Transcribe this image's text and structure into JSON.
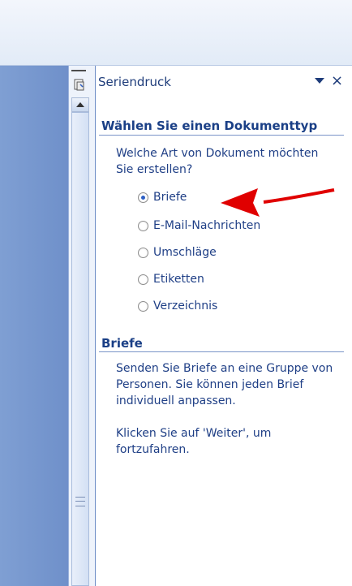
{
  "taskpane": {
    "title": "Seriendruck",
    "close_symbol": "×",
    "menu_icon": "triangle-down-icon",
    "pin_icon": "pin-icon"
  },
  "step": {
    "heading": "Wählen Sie einen Dokumenttyp",
    "question": "Welche Art von Dokument möchten Sie erstellen?",
    "options": [
      {
        "label": "Briefe",
        "checked": true
      },
      {
        "label": "E-Mail-Nachrichten",
        "checked": false
      },
      {
        "label": "Umschläge",
        "checked": false
      },
      {
        "label": "Etiketten",
        "checked": false
      },
      {
        "label": "Verzeichnis",
        "checked": false
      }
    ]
  },
  "info": {
    "heading": "Briefe",
    "description": "Senden Sie Briefe an eine Gruppe von Personen. Sie können jeden Brief individuell anpassen.",
    "hint": "Klicken Sie auf 'Weiter', um fortzufahren."
  },
  "colors": {
    "accent": "#1a3f86",
    "arrow": "#e00000"
  }
}
